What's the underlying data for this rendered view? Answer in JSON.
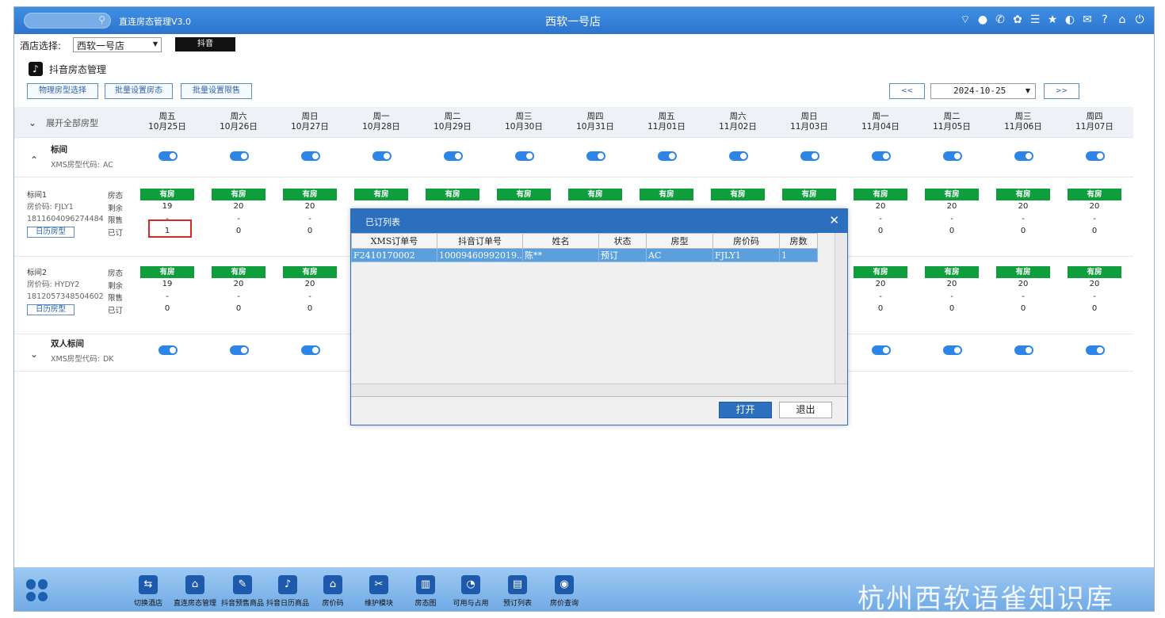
{
  "app": {
    "title": "直连房态管理V3.0",
    "store": "西软一号店"
  },
  "hotel_select": {
    "label": "酒店选择:",
    "value": "西软一号店",
    "channel": "抖音"
  },
  "section": {
    "title": "抖音房态管理"
  },
  "toolbar": {
    "btn1": "物理房型选择",
    "btn2": "批量设置房态",
    "btn3": "批量设置限售",
    "prev": "<<",
    "next": ">>",
    "date": "2024-10-25"
  },
  "header": {
    "expand_all": "展开全部房型",
    "days": [
      {
        "w": "周五",
        "d": "10月25日"
      },
      {
        "w": "周六",
        "d": "10月26日"
      },
      {
        "w": "周日",
        "d": "10月27日"
      },
      {
        "w": "周一",
        "d": "10月28日"
      },
      {
        "w": "周二",
        "d": "10月29日"
      },
      {
        "w": "周三",
        "d": "10月30日"
      },
      {
        "w": "周四",
        "d": "10月31日"
      },
      {
        "w": "周五",
        "d": "11月01日"
      },
      {
        "w": "周六",
        "d": "11月02日"
      },
      {
        "w": "周日",
        "d": "11月03日"
      },
      {
        "w": "周一",
        "d": "11月04日"
      },
      {
        "w": "周二",
        "d": "11月05日"
      },
      {
        "w": "周三",
        "d": "11月06日"
      },
      {
        "w": "周四",
        "d": "11月07日"
      }
    ]
  },
  "row_labels": {
    "status": "房态",
    "remain": "剩余",
    "limit": "限售",
    "booked": "已订"
  },
  "room_types": [
    {
      "name": "标间",
      "code_label": "XMS房型代码:",
      "code": "AC"
    },
    {
      "name": "双人标间",
      "code_label": "XMS房型代码:",
      "code": "DK"
    }
  ],
  "rooms": [
    {
      "name": "标间1",
      "rate_label": "房价码:",
      "rate": "FJLY1",
      "id": "1811604096274484",
      "cal_btn": "日历房型",
      "status": "有房",
      "remain": [
        "19",
        "20",
        "20",
        "",
        "",
        "",
        "",
        "",
        "",
        "",
        "20",
        "20",
        "20",
        "20"
      ],
      "limit": [
        "-",
        "-",
        "-",
        "",
        "",
        "",
        "",
        "",
        "",
        "",
        "-",
        "-",
        "-",
        "-"
      ],
      "booked": [
        "1",
        "0",
        "0",
        "",
        "",
        "",
        "",
        "",
        "",
        "",
        "0",
        "0",
        "0",
        "0"
      ]
    },
    {
      "name": "标间2",
      "rate_label": "房价码:",
      "rate": "HYDY2",
      "id": "1812057348504602",
      "cal_btn": "日历房型",
      "status": "有房",
      "remain": [
        "19",
        "20",
        "20",
        "",
        "",
        "",
        "",
        "",
        "",
        "",
        "20",
        "20",
        "20",
        "20"
      ],
      "limit": [
        "-",
        "-",
        "-",
        "",
        "",
        "",
        "",
        "",
        "",
        "",
        "-",
        "-",
        "-",
        "-"
      ],
      "booked": [
        "0",
        "0",
        "0",
        "",
        "",
        "",
        "",
        "",
        "",
        "",
        "0",
        "0",
        "0",
        "0"
      ]
    }
  ],
  "dialog": {
    "title": "已订列表",
    "columns": [
      "XMS订单号",
      "抖音订单号",
      "姓名",
      "状态",
      "房型",
      "房价码",
      "房数"
    ],
    "rows": [
      [
        "F2410170002",
        "10009460992019...",
        "陈**",
        "预订",
        "AC",
        "FJLY1",
        "1"
      ]
    ],
    "open": "打开",
    "exit": "退出"
  },
  "bottom": {
    "items": [
      "切换酒店",
      "直连房态管理",
      "抖音预售商品",
      "抖音日历商品",
      "房价码",
      "维护模块",
      "房态图",
      "可用与占用",
      "预订列表",
      "房价查询"
    ],
    "watermark": "杭州西软语雀知识库"
  },
  "colors": {
    "primary": "#2d74cf",
    "available": "#0e9e3c",
    "toggle": "#2d85e8",
    "dialog": "#2d6fbf",
    "selected_row": "#5b9fdc"
  }
}
